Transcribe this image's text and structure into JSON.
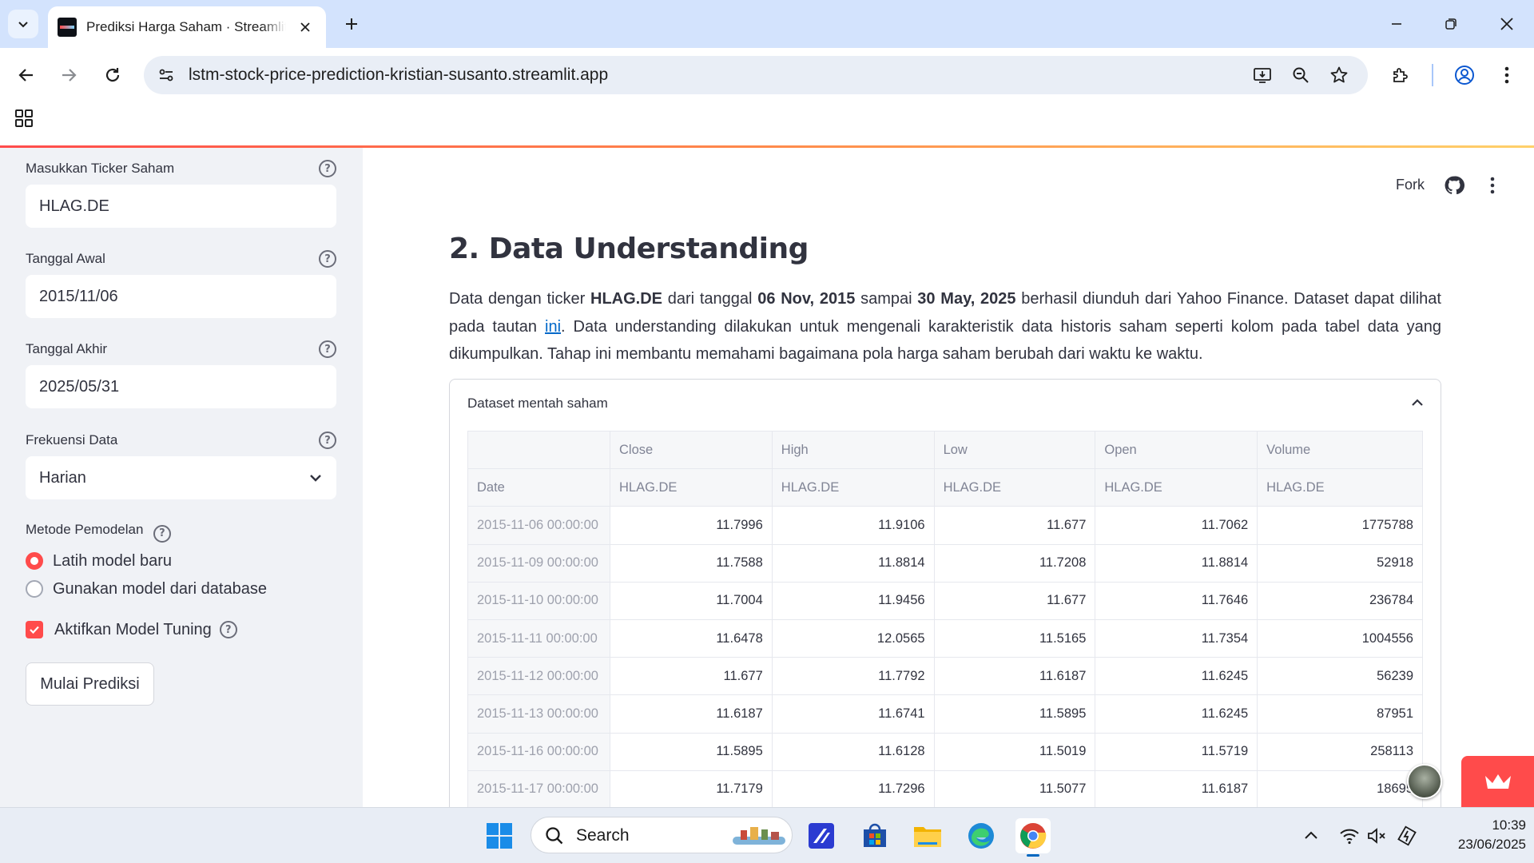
{
  "browser": {
    "tab_title": "Prediksi Harga Saham · Streamlit",
    "url": "lstm-stock-price-prediction-kristian-susanto.streamlit.app"
  },
  "sidebar": {
    "ticker": {
      "label": "Masukkan Ticker Saham",
      "value": "HLAG.DE"
    },
    "start_date": {
      "label": "Tanggal Awal",
      "value": "2015/11/06"
    },
    "end_date": {
      "label": "Tanggal Akhir",
      "value": "2025/05/31"
    },
    "frequency": {
      "label": "Frekuensi Data",
      "value": "Harian"
    },
    "method": {
      "label": "Metode Pemodelan",
      "options": [
        "Latih model baru",
        "Gunakan model dari database"
      ],
      "selected_index": 0
    },
    "tuning": {
      "label": "Aktifkan Model Tuning",
      "checked": true
    },
    "predict_button": "Mulai Prediksi"
  },
  "header": {
    "fork": "Fork"
  },
  "main": {
    "heading": "2. Data Understanding",
    "paragraph": {
      "p1": "Data dengan ticker ",
      "ticker": "HLAG.DE",
      "p2": " dari tanggal ",
      "start": "06 Nov, 2015",
      "p3": " sampai ",
      "end": "30 May, 2025",
      "p4": " berhasil diunduh dari Yahoo Finance. Dataset dapat dilihat pada tautan ",
      "link": "ini",
      "p5": ". Data understanding dilakukan untuk mengenali karakteristik data historis saham seperti kolom pada tabel data yang dikumpulkan. Tahap ini membantu memahami bagaimana pola harga saham berubah dari waktu ke waktu."
    },
    "expander_title": "Dataset mentah saham",
    "table": {
      "columns": [
        "Close",
        "High",
        "Low",
        "Open",
        "Volume"
      ],
      "subheaders": [
        "HLAG.DE",
        "HLAG.DE",
        "HLAG.DE",
        "HLAG.DE",
        "HLAG.DE"
      ],
      "index_name": "Date",
      "rows": [
        [
          "2015-11-06 00:00:00",
          "11.7996",
          "11.9106",
          "11.677",
          "11.7062",
          "1775788"
        ],
        [
          "2015-11-09 00:00:00",
          "11.7588",
          "11.8814",
          "11.7208",
          "11.8814",
          "52918"
        ],
        [
          "2015-11-10 00:00:00",
          "11.7004",
          "11.9456",
          "11.677",
          "11.7646",
          "236784"
        ],
        [
          "2015-11-11 00:00:00",
          "11.6478",
          "12.0565",
          "11.5165",
          "11.7354",
          "1004556"
        ],
        [
          "2015-11-12 00:00:00",
          "11.677",
          "11.7792",
          "11.6187",
          "11.6245",
          "56239"
        ],
        [
          "2015-11-13 00:00:00",
          "11.6187",
          "11.6741",
          "11.5895",
          "11.6245",
          "87951"
        ],
        [
          "2015-11-16 00:00:00",
          "11.5895",
          "11.6128",
          "11.5019",
          "11.5719",
          "258113"
        ],
        [
          "2015-11-17 00:00:00",
          "11.7179",
          "11.7296",
          "11.5077",
          "11.6187",
          "18695"
        ]
      ]
    }
  },
  "taskbar": {
    "search_label": "Search",
    "time": "10:39",
    "date": "23/06/2025"
  },
  "colors": {
    "accent": "#ff4b4b",
    "link": "#0068c9",
    "sidebar_bg": "#f0f2f6"
  }
}
